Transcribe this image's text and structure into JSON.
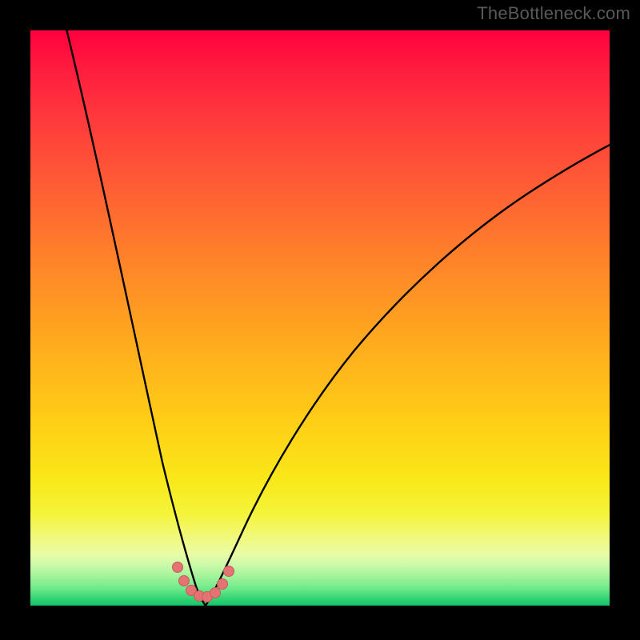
{
  "watermark": "TheBottleneck.com",
  "colors": {
    "frame": "#000000",
    "curve": "#000000",
    "marker_fill": "#e57373",
    "marker_stroke": "#c75a5a"
  },
  "chart_data": {
    "type": "line",
    "title": "",
    "xlabel": "",
    "ylabel": "",
    "xlim": [
      0,
      100
    ],
    "ylim": [
      0,
      100
    ],
    "grid": false,
    "legend": false,
    "series": [
      {
        "name": "bottleneck-curve",
        "note": "Values estimated by position within the 724x719 plot area; y describes vertical position from top (0) to bottom (100). Curve reaches minimum (bottom) near x≈29 and rises on both sides.",
        "x": [
          0,
          5,
          10,
          15,
          20,
          23,
          25,
          27,
          29,
          31,
          33,
          35,
          38,
          42,
          48,
          55,
          63,
          72,
          82,
          92,
          100
        ],
        "y": [
          0,
          20,
          40,
          60,
          80,
          90,
          95,
          98,
          99,
          98,
          96,
          93,
          88,
          80,
          70,
          60,
          50,
          40,
          30,
          22,
          17
        ]
      }
    ],
    "markers": {
      "name": "highlighted-range",
      "note": "Small salmon dotted U-shaped highlight near curve minimum.",
      "points": [
        {
          "x": 24.5,
          "y": 93.5
        },
        {
          "x": 25.5,
          "y": 96.0
        },
        {
          "x": 26.7,
          "y": 97.7
        },
        {
          "x": 28.0,
          "y": 98.6
        },
        {
          "x": 29.3,
          "y": 98.7
        },
        {
          "x": 30.6,
          "y": 98.0
        },
        {
          "x": 31.8,
          "y": 96.4
        },
        {
          "x": 32.8,
          "y": 94.2
        }
      ]
    },
    "background_gradient_note": "Vertical gradient from red (top, high bottleneck) through orange/yellow to green (bottom, low bottleneck)."
  }
}
